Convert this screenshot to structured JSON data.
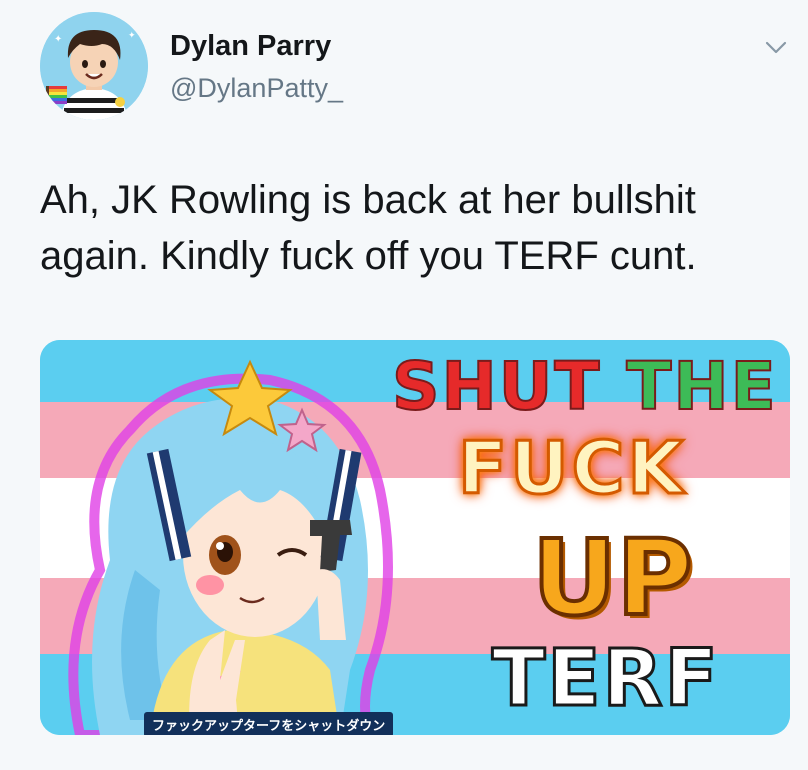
{
  "author": {
    "name": "Dylan Parry",
    "handle": "@DylanPatty_"
  },
  "tweet": {
    "text": "Ah, JK Rowling is back at her bullshit again. Kindly fuck off you TERF cunt."
  },
  "media": {
    "line1_word1": "SHUT",
    "line1_word2": "THE",
    "line2": "FUCK",
    "line3": "UP",
    "line4": "TERF",
    "caption_jp": "ファックアップターフをシャットダウン"
  },
  "icons": {
    "caret": "chevron-down-icon",
    "avatar": "avatar"
  },
  "colors": {
    "background": "#f5f8fa",
    "flag_blue": "#5bcef0",
    "flag_pink": "#f5a9b8",
    "flag_white": "#ffffff",
    "name_text": "#14171a",
    "handle_text": "#657786"
  }
}
